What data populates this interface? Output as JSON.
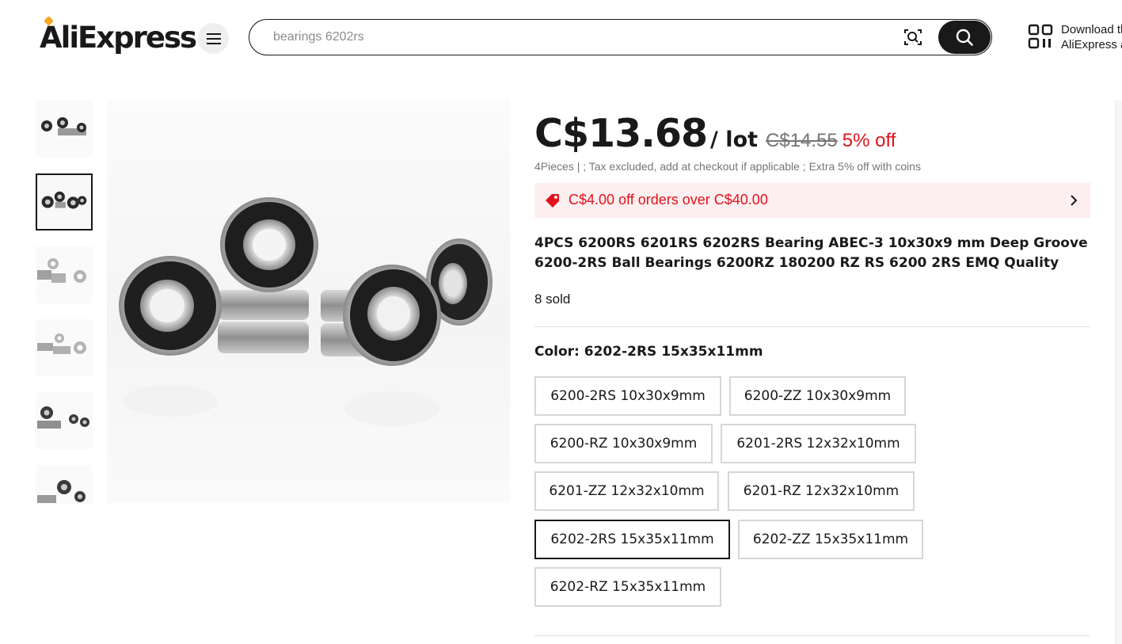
{
  "header": {
    "logo": "AliExpress",
    "search_placeholder": "bearings 6202rs",
    "download_line1": "Download the",
    "download_line2": "AliExpress app",
    "icons": [
      "menu-icon",
      "image-search-icon",
      "search-icon",
      "qr-code-icon"
    ]
  },
  "gallery": {
    "thumbnail_count": 6,
    "active_index": 1
  },
  "product": {
    "price": "C$13.68",
    "unit": "/ lot",
    "original_price": "C$14.55",
    "discount": "5% off",
    "sub_note": "4Pieces | ; Tax excluded, add at checkout if applicable ; Extra 5% off with coins",
    "coupon": "C$4.00 off orders over C$40.00",
    "title": "4PCS 6200RS 6201RS 6202RS Bearing ABEC-3 10x30x9 mm Deep Groove 6200-2RS Ball Bearings 6200RZ 180200 RZ RS 6200 2RS EMQ Quality",
    "sold": "8 sold",
    "color_label": "Color: 6202-2RS 15x35x11mm"
  },
  "options": [
    {
      "label": "6200-2RS 10x30x9mm",
      "selected": false
    },
    {
      "label": "6200-ZZ 10x30x9mm",
      "selected": false
    },
    {
      "label": "6200-RZ 10x30x9mm",
      "selected": false
    },
    {
      "label": "6201-2RS 12x32x10mm",
      "selected": false
    },
    {
      "label": "6201-ZZ 12x32x10mm",
      "selected": false
    },
    {
      "label": "6201-RZ 12x32x10mm",
      "selected": false
    },
    {
      "label": "6202-2RS 15x35x11mm",
      "selected": true
    },
    {
      "label": "6202-ZZ 15x35x11mm",
      "selected": false
    },
    {
      "label": "6202-RZ 15x35x11mm",
      "selected": false
    }
  ],
  "colors": {
    "accent_red": "#e1121b",
    "coupon_bg": "#fdeff0",
    "text_dark": "#191919",
    "muted": "#757575"
  }
}
